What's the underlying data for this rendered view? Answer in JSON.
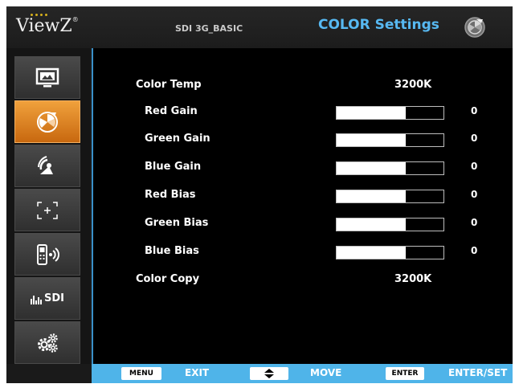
{
  "header": {
    "logo": "ViewZ",
    "logo_mark": "®",
    "model": "SDI 3G_BASIC",
    "title": "COLOR Settings",
    "title_color": "#57b9f2",
    "icon": "color-wheel-icon"
  },
  "sidebar": {
    "items": [
      {
        "icon": "picture-icon",
        "active": false
      },
      {
        "icon": "color-wheel-icon",
        "active": true
      },
      {
        "icon": "audio-icon",
        "active": false
      },
      {
        "icon": "marker-icon",
        "active": false
      },
      {
        "icon": "remote-icon",
        "active": false
      },
      {
        "icon": "sdi-icon",
        "label": "SDI",
        "active": false
      },
      {
        "icon": "settings-icon",
        "active": false
      }
    ],
    "active_color": "#e8862a"
  },
  "settings": {
    "color_temp": {
      "label": "Color Temp",
      "value": "3200K"
    },
    "gains": [
      {
        "label": "Red Gain",
        "value": "0",
        "level": 0.65
      },
      {
        "label": "Green Gain",
        "value": "0",
        "level": 0.65
      },
      {
        "label": "Blue Gain",
        "value": "0",
        "level": 0.65
      },
      {
        "label": "Red Bias",
        "value": "0",
        "level": 0.65
      },
      {
        "label": "Green Bias",
        "value": "0",
        "level": 0.65
      },
      {
        "label": "Blue Bias",
        "value": "0",
        "level": 0.65
      }
    ],
    "color_copy": {
      "label": "Color Copy",
      "value": "3200K"
    }
  },
  "footer": {
    "menu_key": "MENU",
    "exit_label": "EXIT",
    "move_label": "MOVE",
    "enter_key": "ENTER",
    "enter_label": "ENTER/SET",
    "bar_color": "#4fb4e9"
  }
}
